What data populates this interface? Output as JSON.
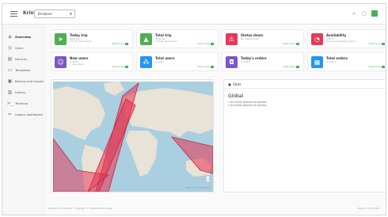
{
  "header": {
    "brand": "Krist",
    "select_value": "Brisbane",
    "icons": [
      "search-icon",
      "user-icon",
      "status-square-icon"
    ]
  },
  "sidebar": {
    "items": [
      {
        "label": "Overview",
        "icon": "home-icon"
      },
      {
        "label": "Users",
        "icon": "users-icon"
      },
      {
        "label": "Devices",
        "icon": "devices-icon"
      },
      {
        "label": "Templates",
        "icon": "template-icon"
      },
      {
        "label": "Backup and import",
        "icon": "backup-icon"
      },
      {
        "label": "History",
        "icon": "history-icon"
      },
      {
        "label": "Terminal",
        "icon": "terminal-icon"
      },
      {
        "label": "Legacy dashboard",
        "icon": "back-arrow-icon"
      }
    ]
  },
  "cards": [
    {
      "title": "Today trip",
      "sub1": "Next trip",
      "sub2": "14 trip discovered",
      "more": "View more",
      "icon": "navigation-arrow-icon",
      "color": "#4caf50"
    },
    {
      "title": "Total trip",
      "sub1": "Total trip",
      "sub2": "14 trip discovered",
      "more": "View more",
      "icon": "road-icon",
      "color": "#4caf50"
    },
    {
      "title": "Status down",
      "sub1": "No status down",
      "sub2": "",
      "more": "View more",
      "icon": "warning-icon",
      "color": "#e53958"
    },
    {
      "title": "Availability",
      "sub1": "100 %",
      "sub2": "Devices are being online",
      "more": "View more",
      "icon": "gauge-icon",
      "color": "#e53958"
    },
    {
      "title": "New users",
      "sub1": "0 users",
      "sub2": "1 new users",
      "more": "View more",
      "icon": "person-icon",
      "color": "#7e57c2"
    },
    {
      "title": "Total users",
      "sub1": "0 users",
      "sub2": "",
      "more": "View more",
      "icon": "group-icon",
      "color": "#2196f3"
    },
    {
      "title": "Today's orders",
      "sub1": "0 orders",
      "sub2": "",
      "more": "View more",
      "icon": "shopping-bag-icon",
      "color": "#7e57c2"
    },
    {
      "title": "Total orders",
      "sub1": "0 orders",
      "sub2": "",
      "more": "View more",
      "icon": "orders-icon",
      "color": "#2196f3"
    }
  ],
  "map": {
    "zoom_in": "+",
    "zoom_out": "−",
    "attribution": "Leaflet | © OpenStreetMap"
  },
  "stats_panel": {
    "header": "Stats",
    "title": "Global",
    "line1": "All online devices at location",
    "line2": "All online devices at location"
  },
  "footer": {
    "left": "Based on accuStore · Copyright © 2018 Broad Cruiser",
    "right": "Version 7.8.0 beta"
  },
  "colors": {
    "green": "#4caf50",
    "red": "#e53958",
    "purple": "#7e57c2",
    "blue": "#2196f3",
    "route": "#e8324f"
  }
}
